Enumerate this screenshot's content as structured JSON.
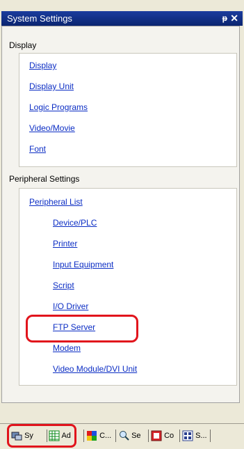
{
  "window": {
    "title": "System Settings",
    "pin_glyph": "ᵽ",
    "close_glyph": "✕"
  },
  "display_section": {
    "header": "Display",
    "items": [
      {
        "label": "Display"
      },
      {
        "label": "Display Unit"
      },
      {
        "label": "Logic Programs"
      },
      {
        "label": "Video/Movie"
      },
      {
        "label": "Font"
      }
    ]
  },
  "peripheral_section": {
    "header": "Peripheral Settings",
    "list_label": "Peripheral List",
    "items": [
      {
        "label": "Device/PLC"
      },
      {
        "label": "Printer"
      },
      {
        "label": "Input Equipment"
      },
      {
        "label": "Script"
      },
      {
        "label": "I/O Driver"
      },
      {
        "label": "FTP Server"
      },
      {
        "label": "Modem"
      },
      {
        "label": "Video Module/DVI Unit"
      }
    ]
  },
  "bottom_tabs": [
    {
      "label": "Sy",
      "icon": "system-settings-icon"
    },
    {
      "label": "Ad",
      "icon": "address-grid-icon"
    },
    {
      "label": "C...",
      "icon": "color-palette-icon"
    },
    {
      "label": "Se",
      "icon": "search-icon"
    },
    {
      "label": "Co",
      "icon": "common-icon"
    },
    {
      "label": "S...",
      "icon": "screen-list-icon"
    }
  ],
  "colors": {
    "link": "#0b2dc4",
    "highlight": "#e1141c",
    "titlebar": "#0a2470"
  }
}
